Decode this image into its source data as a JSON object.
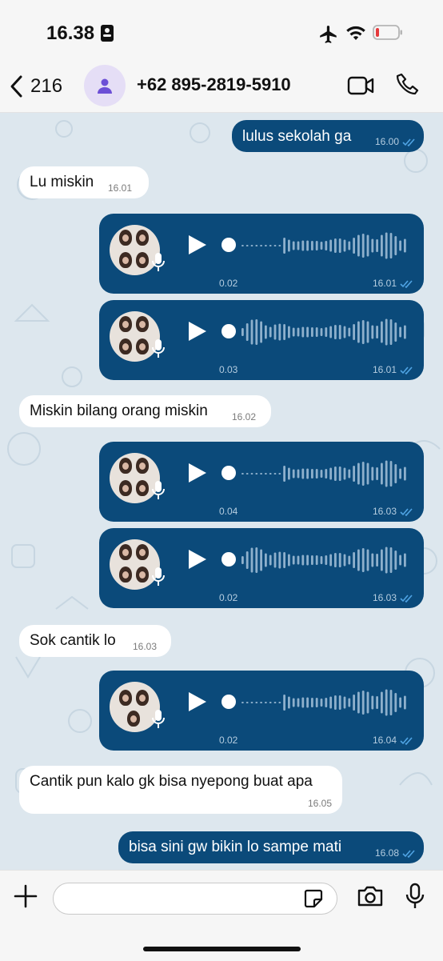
{
  "status": {
    "time": "16.38"
  },
  "header": {
    "back_count": "216",
    "contact": "+62 895-2819-5910"
  },
  "messages": [
    {
      "kind": "text",
      "dir": "out",
      "text": "lulus sekolah ga",
      "time": "16.00"
    },
    {
      "kind": "text",
      "dir": "in",
      "text": "Lu miskin",
      "time": "16.01"
    },
    {
      "kind": "voice",
      "dir": "out",
      "duration": "0.02",
      "time": "16.01"
    },
    {
      "kind": "voice",
      "dir": "out",
      "duration": "0.03",
      "time": "16.01"
    },
    {
      "kind": "text",
      "dir": "in",
      "text": "Miskin bilang orang miskin",
      "time": "16.02"
    },
    {
      "kind": "voice",
      "dir": "out",
      "duration": "0.04",
      "time": "16.03"
    },
    {
      "kind": "voice",
      "dir": "out",
      "duration": "0.02",
      "time": "16.03"
    },
    {
      "kind": "text",
      "dir": "in",
      "text": "Sok cantik lo",
      "time": "16.03"
    },
    {
      "kind": "voice",
      "dir": "out",
      "duration": "0.02",
      "time": "16.04"
    },
    {
      "kind": "text",
      "dir": "in",
      "text": "Cantik pun kalo gk bisa nyepong buat apa",
      "time": "16.05"
    },
    {
      "kind": "text",
      "dir": "out",
      "text": "bisa sini gw bikin lo sampe mati",
      "time": "16.08"
    }
  ],
  "input": {
    "value": "",
    "placeholder": ""
  },
  "colors": {
    "outgoing": "#0b4a7a",
    "incoming": "#ffffff",
    "chat_bg": "#dde7ee",
    "read_ticks": "#4fa3e3"
  }
}
